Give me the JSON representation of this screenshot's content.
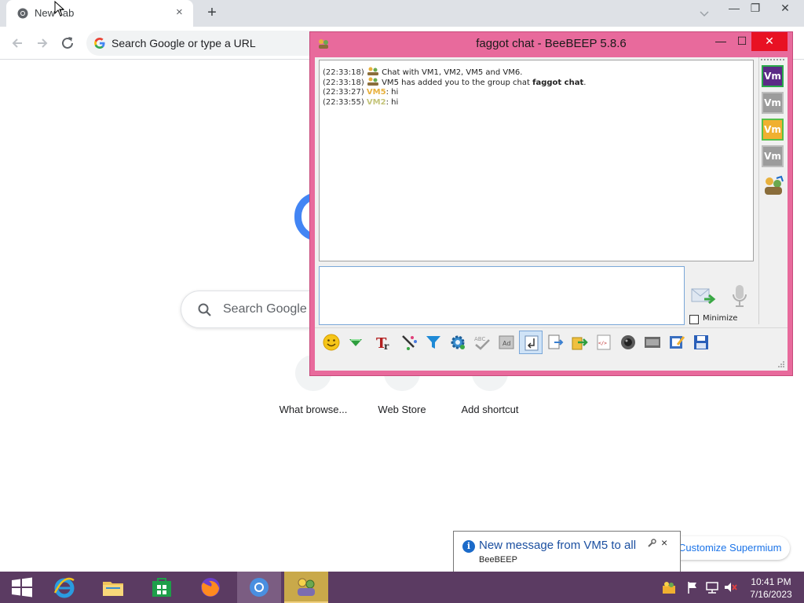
{
  "browser": {
    "tab": {
      "title": "New Tab",
      "close": "×"
    },
    "new_tab": "+",
    "omnibox": {
      "text": "Search Google or type a URL"
    },
    "window_controls": {
      "minimize": "—",
      "maximize": "❐",
      "close": "✕"
    }
  },
  "ntp": {
    "search_placeholder": "Search Google o",
    "shortcuts": [
      {
        "label": "What browse..."
      },
      {
        "label": "Web Store"
      },
      {
        "label": "Add shortcut"
      }
    ],
    "customize_label": "Customize Supermium"
  },
  "beebeep": {
    "title": "faggot chat - BeeBEEP 5.8.6",
    "controls": {
      "minimize": "—",
      "maximize": "☐",
      "close": "✕"
    },
    "messages": [
      {
        "time": "(22:33:18)",
        "text": "Chat with VM1, VM2, VM5 and VM6."
      },
      {
        "time": "(22:33:18)",
        "text_before": "VM5 has added you to the group chat ",
        "bold": "faggot chat",
        "text_after": "."
      },
      {
        "time": "(22:33:27)",
        "user": "VM5",
        "text": ": hi"
      },
      {
        "time": "(22:33:55)",
        "user": "VM2",
        "text": ": hi"
      }
    ],
    "users": [
      "Vm",
      "Vm",
      "Vm",
      "Vm"
    ],
    "minimize_label": "Minimize"
  },
  "notification": {
    "title": "New message from VM5 to all",
    "body": "BeeBEEP",
    "close": "×"
  },
  "taskbar": {
    "time": "10:41 PM",
    "date": "7/16/2023"
  },
  "colors": {
    "beebeep_frame": "#e86a9c",
    "taskbar": "#5b3b62",
    "vm5_name": "#e8b13d",
    "vm2_name": "#c4c47a",
    "notification_title": "#1b4fa0"
  }
}
